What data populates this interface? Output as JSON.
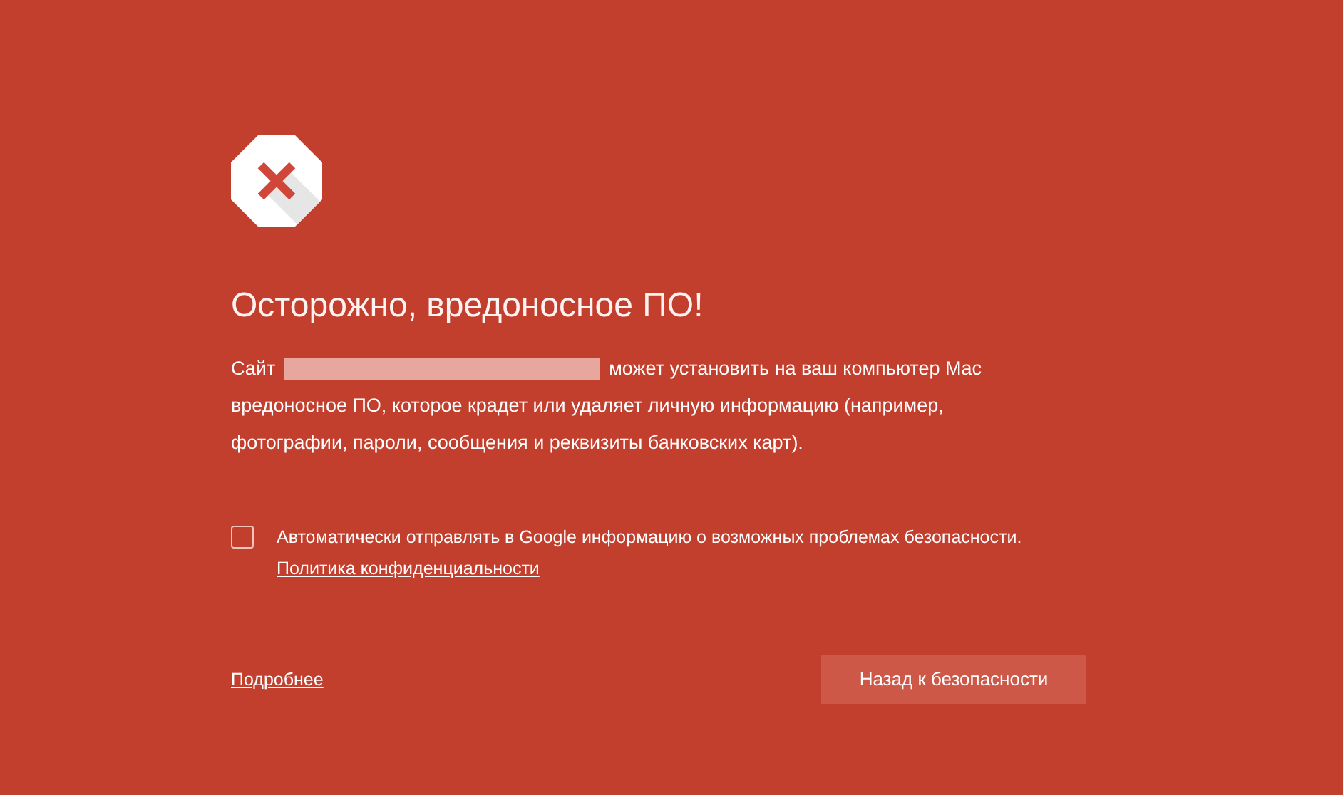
{
  "title": "Осторожно, вредоносное ПО!",
  "description": {
    "prefix": "Сайт",
    "first_line": "может установить на ваш компьютер Mac",
    "rest": "вредоносное ПО, которое крадет или удаляет личную информацию (например, фотографии, пароли, сообщения и реквизиты банковских карт)."
  },
  "report_option": {
    "label": "Автоматически отправлять в Google информацию о возможных проблемах безопасности.",
    "checked": false,
    "link": "Политика конфиденциальности"
  },
  "details_link": "Подробнее",
  "back_button": "Назад к безопасности"
}
